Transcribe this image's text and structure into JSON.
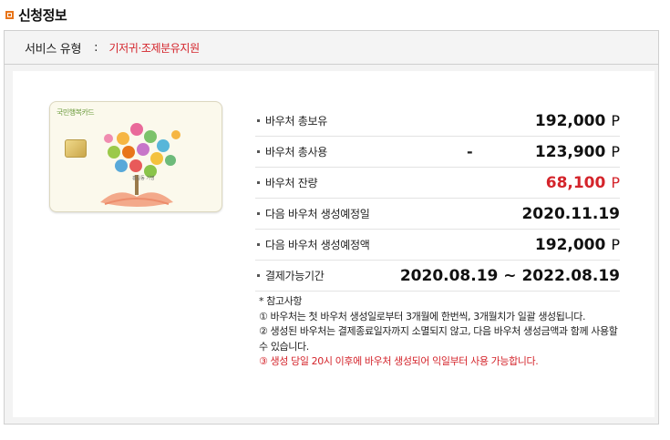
{
  "section": {
    "title": "신청정보"
  },
  "service": {
    "label": "서비스 유형",
    "colon": ":",
    "value": "기저귀·조제분유지원"
  },
  "card": {
    "brand": "국민행복카드",
    "name": "홍길동 기명"
  },
  "rows": [
    {
      "label": "바우처 총보유",
      "value": "192,000",
      "unit": "P"
    },
    {
      "label": "바우처 총사용",
      "prefix": "-",
      "value": "123,900",
      "unit": "P"
    },
    {
      "label": "바우처 잔량",
      "value": "68,100",
      "unit": "P"
    },
    {
      "label": "다음 바우처 생성예정일",
      "value": "2020.11.19"
    },
    {
      "label": "다음 바우처 생성예정액",
      "value": "192,000",
      "unit": "P"
    },
    {
      "label": "결제가능기간",
      "value": "2020.08.19 ~ 2022.08.19"
    }
  ],
  "notes": {
    "header": "* 참고사항",
    "note1": "① 바우처는 첫 바우처 생성일로부터 3개월에 한번씩, 3개월치가 일괄 생성됩니다.",
    "note2": "② 생성된 바우처는 결제종료일자까지 소멸되지 않고, 다음 바우처 생성금액과 함께 사용할 수 있습니다.",
    "note3": "③ 생성 당일 20시 이후에 바우처 생성되어 익일부터 사용 가능합니다."
  },
  "colors": {
    "accent": "#e8751a",
    "highlight": "#d4242b"
  }
}
